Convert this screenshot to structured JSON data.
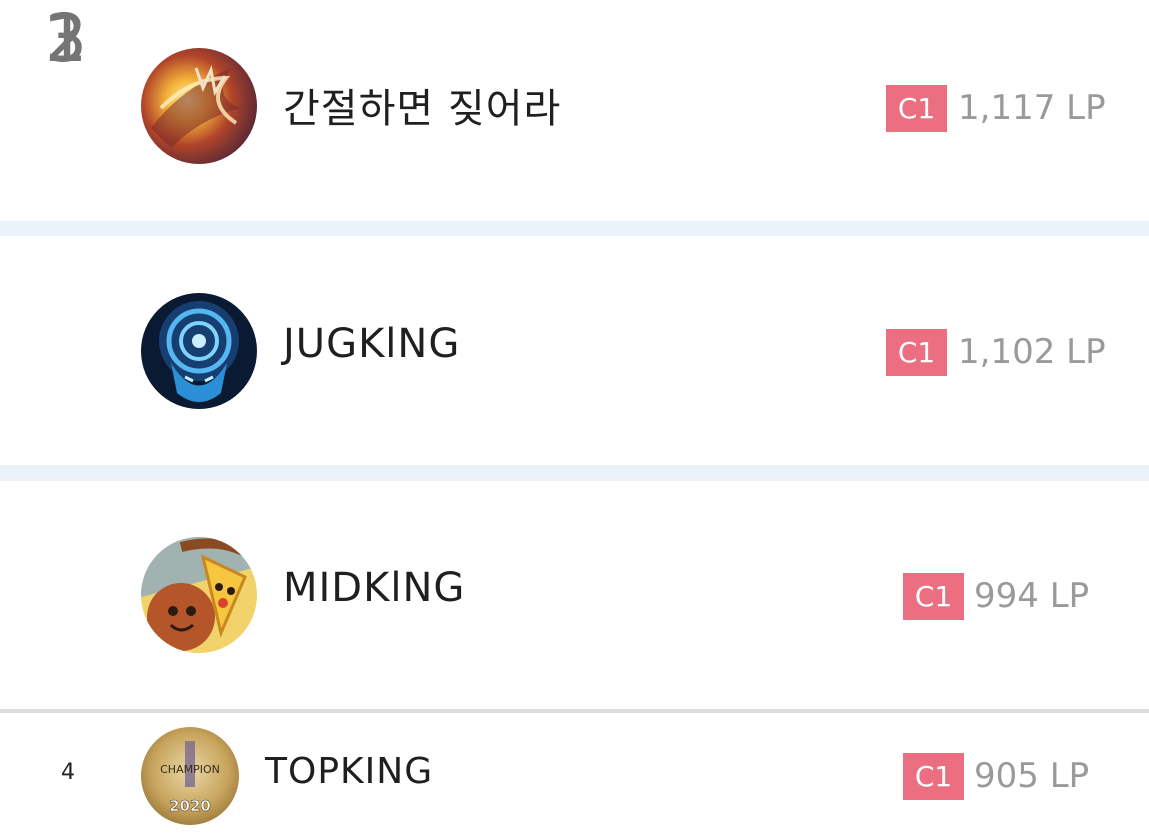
{
  "rankings": [
    {
      "rank": "1",
      "name": "간절하면 짖어라",
      "tier": "C1",
      "lp": "1,117 LP"
    },
    {
      "rank": "2",
      "name": "JUGKlNG",
      "tier": "C1",
      "lp": "1,102 LP"
    },
    {
      "rank": "3",
      "name": "MIDKlNG",
      "tier": "C1",
      "lp": "994 LP"
    },
    {
      "rank": "4",
      "name": "TOPKING",
      "tier": "C1",
      "lp": "905 LP"
    }
  ],
  "avatars": [
    {
      "icon": "fire-dragon-icon"
    },
    {
      "icon": "blue-spirit-mask-icon"
    },
    {
      "icon": "pizza-cartoon-icon"
    },
    {
      "icon": "champion-2020-badge-icon",
      "text_top": "CHAMPION",
      "text_bottom": "2020"
    }
  ],
  "colors": {
    "tier_badge": "#ec6f81",
    "lp_text": "#9a9a9a",
    "separator": "#e9f3f9",
    "rank_text": "#757575"
  }
}
